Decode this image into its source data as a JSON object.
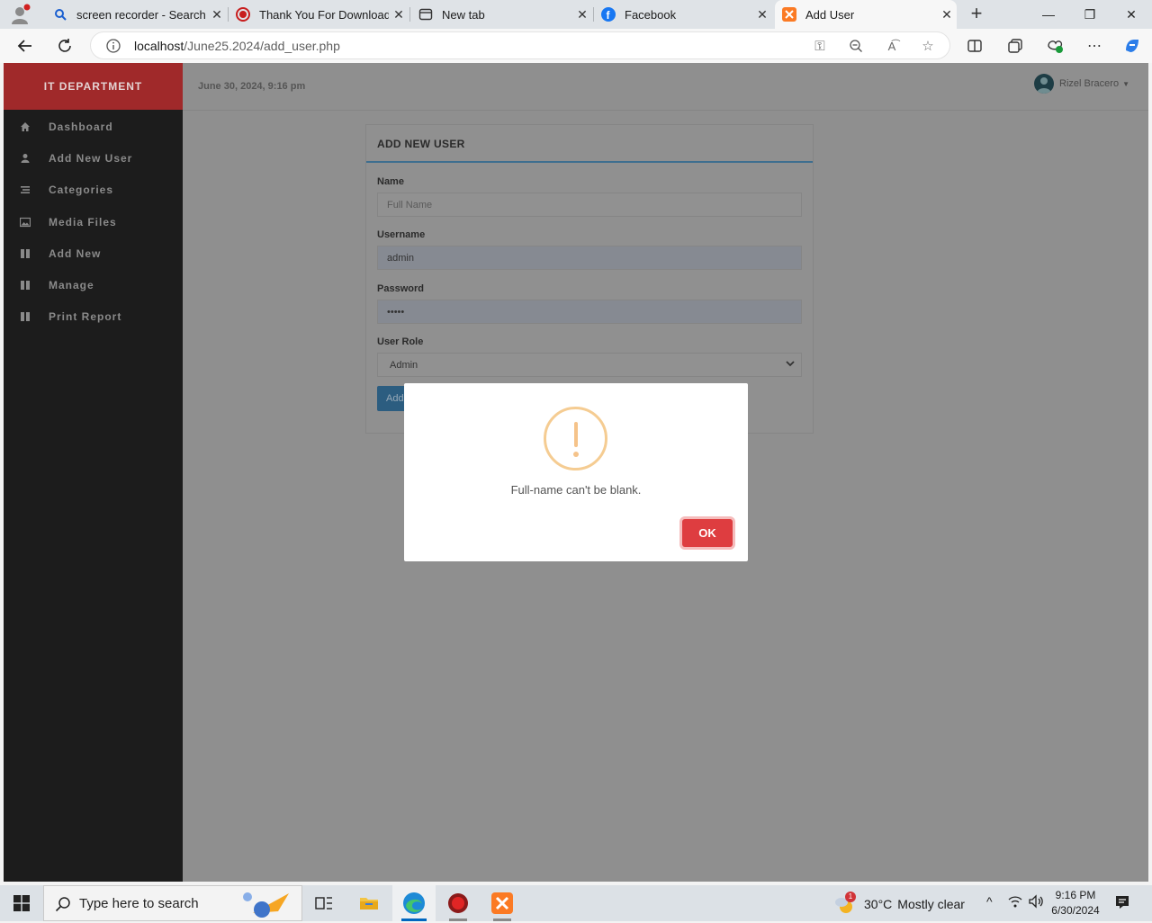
{
  "browser": {
    "tabs": [
      {
        "label": "screen recorder - Search",
        "icon": "search-icon"
      },
      {
        "label": "Thank You For Downloadin",
        "icon": "record-icon"
      },
      {
        "label": "New tab",
        "icon": "newtab-icon"
      },
      {
        "label": "Facebook",
        "icon": "facebook-icon"
      },
      {
        "label": "Add User",
        "icon": "xampp-icon",
        "active": true
      }
    ],
    "url_host": "localhost",
    "url_path": "/June25.2024/add_user.php"
  },
  "app": {
    "brand": "IT DEPARTMENT",
    "datetime": "June 30, 2024, 9:16 pm",
    "user_name": "Rizel Bracero",
    "sidebar": [
      {
        "label": "Dashboard",
        "icon": "home-icon"
      },
      {
        "label": "Add New User",
        "icon": "user-icon"
      },
      {
        "label": "Categories",
        "icon": "list-icon"
      },
      {
        "label": "Media Files",
        "icon": "image-icon"
      },
      {
        "label": "Add New",
        "icon": "grid-icon"
      },
      {
        "label": "Manage",
        "icon": "grid-icon"
      },
      {
        "label": "Print Report",
        "icon": "grid-icon"
      }
    ]
  },
  "form": {
    "title": "ADD NEW USER",
    "name_label": "Name",
    "name_placeholder": "Full Name",
    "username_label": "Username",
    "username_value": "admin",
    "password_label": "Password",
    "password_value": "•••••",
    "role_label": "User Role",
    "role_value": "Admin",
    "add_button": "Add"
  },
  "modal": {
    "message": "Full-name can't be blank.",
    "ok_label": "OK",
    "icon": "warning-icon"
  },
  "taskbar": {
    "search_placeholder": "Type here to search",
    "weather_temp": "30°C",
    "weather_desc": "Mostly clear",
    "weather_badge": "1",
    "time": "9:16 PM",
    "date": "6/30/2024"
  },
  "colors": {
    "brand_red": "#a0292a",
    "sidebar_bg": "#1c1c1c",
    "ok_button": "#de3d40",
    "warning": "#f5cc92"
  }
}
